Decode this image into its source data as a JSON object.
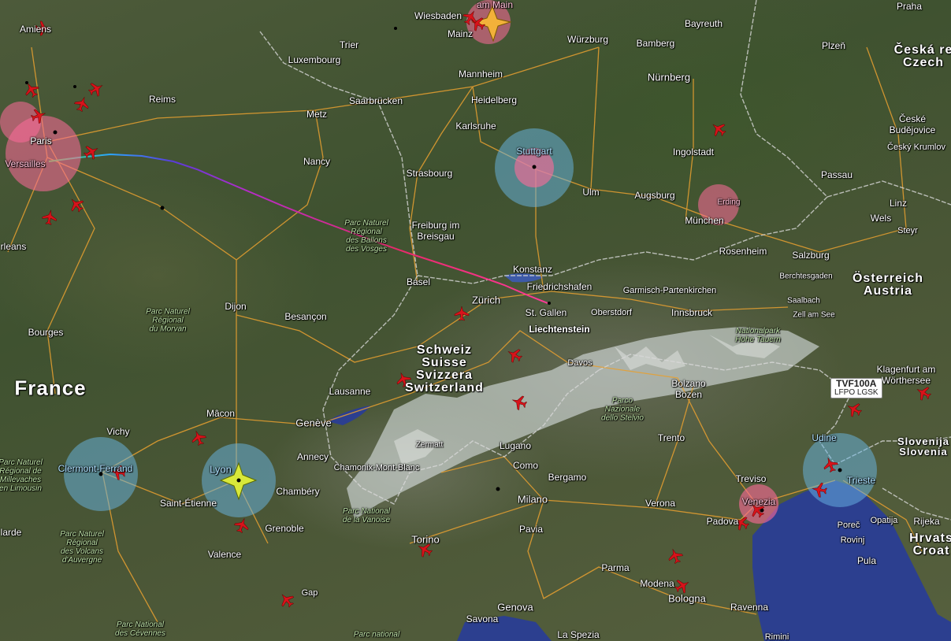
{
  "map": {
    "countries": [
      {
        "key": "france",
        "text": "France"
      },
      {
        "key": "schweiz",
        "text": "Schweiz\nSuisse\nSvizzera\nSwitzerland"
      },
      {
        "key": "osterreich",
        "text": "Österreich\nAustria"
      },
      {
        "key": "czech",
        "text": "Česká re\nCzech"
      },
      {
        "key": "slovenia",
        "text": "Slovenija\nSlovenia"
      },
      {
        "key": "hrvatska",
        "text": "Hrvats\nCroat"
      }
    ],
    "cities": [
      {
        "key": "amiens",
        "text": "Amiens"
      },
      {
        "key": "wiesbaden",
        "text": "Wiesbaden"
      },
      {
        "key": "ammain",
        "text": "am Main"
      },
      {
        "key": "mainz",
        "text": "Mainz"
      },
      {
        "key": "bayreuth",
        "text": "Bayreuth"
      },
      {
        "key": "praha",
        "text": "Praha"
      },
      {
        "key": "trier",
        "text": "Trier"
      },
      {
        "key": "wurzburg",
        "text": "Würzburg"
      },
      {
        "key": "luxembourg",
        "text": "Luxembourg"
      },
      {
        "key": "bamberg",
        "text": "Bamberg"
      },
      {
        "key": "plzen",
        "text": "Plzeň"
      },
      {
        "key": "mannheim",
        "text": "Mannheim"
      },
      {
        "key": "nurnberg",
        "text": "Nürnberg"
      },
      {
        "key": "reims",
        "text": "Reims"
      },
      {
        "key": "saarbrucken",
        "text": "Saarbrücken"
      },
      {
        "key": "heidelberg",
        "text": "Heidelberg"
      },
      {
        "key": "metz",
        "text": "Metz"
      },
      {
        "key": "karlsruhe",
        "text": "Karlsruhe"
      },
      {
        "key": "ceske",
        "text": "České\nBudějovice"
      },
      {
        "key": "paris",
        "text": "Paris"
      },
      {
        "key": "versailles",
        "text": "Versailles"
      },
      {
        "key": "ingolstadt",
        "text": "Ingolstadt"
      },
      {
        "key": "ceskykrumlov",
        "text": "Český Krumlov"
      },
      {
        "key": "stuttgart",
        "text": "Stuttgart"
      },
      {
        "key": "nancy",
        "text": "Nancy"
      },
      {
        "key": "strasbourg",
        "text": "Strasbourg"
      },
      {
        "key": "passau",
        "text": "Passau"
      },
      {
        "key": "ulm",
        "text": "Ulm"
      },
      {
        "key": "augsburg",
        "text": "Augsburg"
      },
      {
        "key": "erding",
        "text": "Erding"
      },
      {
        "key": "linz",
        "text": "Linz"
      },
      {
        "key": "munchen",
        "text": "München"
      },
      {
        "key": "wels",
        "text": "Wels"
      },
      {
        "key": "steyr",
        "text": "Steyr"
      },
      {
        "key": "freiburg",
        "text": "Freiburg im\nBreisgau"
      },
      {
        "key": "orleans",
        "text": "rleans"
      },
      {
        "key": "rosenheim",
        "text": "Rosenheim"
      },
      {
        "key": "salzburg",
        "text": "Salzburg"
      },
      {
        "key": "konstanz",
        "text": "Konstanz"
      },
      {
        "key": "berchtesgaden",
        "text": "Berchtesgaden"
      },
      {
        "key": "basel",
        "text": "Basel"
      },
      {
        "key": "friedrichshafen",
        "text": "Friedrichshafen"
      },
      {
        "key": "garmisch",
        "text": "Garmisch-Partenkirchen"
      },
      {
        "key": "dijon",
        "text": "Dijon"
      },
      {
        "key": "zurich",
        "text": "Zürich"
      },
      {
        "key": "saalbach",
        "text": "Saalbach"
      },
      {
        "key": "besancon",
        "text": "Besançon"
      },
      {
        "key": "stgallen",
        "text": "St. Gallen"
      },
      {
        "key": "oberstdorf",
        "text": "Oberstdorf"
      },
      {
        "key": "innsbruck",
        "text": "Innsbruck"
      },
      {
        "key": "zellamsee",
        "text": "Zell am See"
      },
      {
        "key": "liechtenstein",
        "text": "Liechtenstein"
      },
      {
        "key": "bourges",
        "text": "Bourges"
      },
      {
        "key": "davos",
        "text": "Davos"
      },
      {
        "key": "klagenfurt",
        "text": "Klagenfurt am\nWörthersee"
      },
      {
        "key": "lausanne",
        "text": "Lausanne"
      },
      {
        "key": "bolzano",
        "text": "Bolzano\nBozen"
      },
      {
        "key": "macon",
        "text": "Mâcon"
      },
      {
        "key": "geneve",
        "text": "Genève"
      },
      {
        "key": "vichy",
        "text": "Vichy"
      },
      {
        "key": "trento",
        "text": "Trento"
      },
      {
        "key": "udine",
        "text": "Udine"
      },
      {
        "key": "zermatt",
        "text": "Zermatt"
      },
      {
        "key": "lugano",
        "text": "Lugano"
      },
      {
        "key": "annecy",
        "text": "Annecy"
      },
      {
        "key": "clermont",
        "text": "Clermont-Ferrand"
      },
      {
        "key": "chamonix",
        "text": "Chamonix-Mont-Blanc"
      },
      {
        "key": "como",
        "text": "Como"
      },
      {
        "key": "lyon",
        "text": "Lyon"
      },
      {
        "key": "bergamo",
        "text": "Bergamo"
      },
      {
        "key": "treviso",
        "text": "Treviso"
      },
      {
        "key": "trieste",
        "text": "Trieste"
      },
      {
        "key": "chambery",
        "text": "Chambéry"
      },
      {
        "key": "milano",
        "text": "Milano"
      },
      {
        "key": "verona",
        "text": "Verona"
      },
      {
        "key": "venezia",
        "text": "Venezia"
      },
      {
        "key": "saintetienne",
        "text": "Saint-Étienne"
      },
      {
        "key": "padova",
        "text": "Padova"
      },
      {
        "key": "grenoble",
        "text": "Grenoble"
      },
      {
        "key": "porec",
        "text": "Poreč"
      },
      {
        "key": "opatija",
        "text": "Opatija"
      },
      {
        "key": "rijeka",
        "text": "Rijeka"
      },
      {
        "key": "lande",
        "text": "larde"
      },
      {
        "key": "pavia",
        "text": "Pavia"
      },
      {
        "key": "torino",
        "text": "Torino"
      },
      {
        "key": "rovinj",
        "text": "Rovinj"
      },
      {
        "key": "valence",
        "text": "Valence"
      },
      {
        "key": "pula",
        "text": "Pula"
      },
      {
        "key": "parma",
        "text": "Parma"
      },
      {
        "key": "modena",
        "text": "Modena"
      },
      {
        "key": "gap",
        "text": "Gap"
      },
      {
        "key": "bologna",
        "text": "Bologna"
      },
      {
        "key": "ravenna",
        "text": "Ravenna"
      },
      {
        "key": "genova",
        "text": "Genova"
      },
      {
        "key": "savona",
        "text": "Savona"
      },
      {
        "key": "laspezia",
        "text": "La Spezia"
      },
      {
        "key": "rimini",
        "text": "Rimini"
      }
    ],
    "parks": [
      {
        "key": "ballons",
        "text": "Parc Naturel\nRégional\ndes Ballons\ndes Vosges"
      },
      {
        "key": "morvan",
        "text": "Parc Naturel\nRégional\ndu Morvan"
      },
      {
        "key": "hohetauern",
        "text": "Nationalpark\nHohe Tauern"
      },
      {
        "key": "stelvio",
        "text": "Parco\nNazionale\ndello Stelvio"
      },
      {
        "key": "vanoise",
        "text": "Parc National\nde la Vanoise"
      },
      {
        "key": "millevaches",
        "text": "Parc Naturel\nRégional de\nMillevaches\nen Limousin"
      },
      {
        "key": "volcans",
        "text": "Parc Naturel\nRégional\ndes Volcans\nd'Auvergne"
      },
      {
        "key": "cevennes",
        "text": "Parc National\ndes Cévennes"
      },
      {
        "key": "parcnational",
        "text": "Parc national"
      }
    ],
    "flight_tag": {
      "callsign": "TVF100A",
      "route": "LFPO LGSK"
    },
    "colors": {
      "airport_pink": "#ff6b9a",
      "airport_blue": "#6ab8e8",
      "plane": "#d8131b",
      "road": "#e8a030",
      "border": "#d8d8d8",
      "sea": "#2c3f8f",
      "snow": "#e8eef2"
    },
    "icons": [
      "plane-icon",
      "star-icon",
      "city-dot-icon"
    ]
  }
}
